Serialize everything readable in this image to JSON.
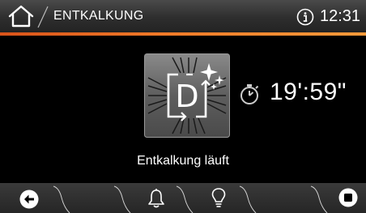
{
  "header": {
    "title": "ENTKALKUNG",
    "time": "12:31",
    "home_icon": "home-icon",
    "info_icon": "info-icon",
    "accent_color": "#f07a28"
  },
  "main": {
    "program_icon": "descaling-icon",
    "program_letter": "D",
    "timer_icon": "stopwatch-icon",
    "remaining_time": "19':59\"",
    "status": "Entkalkung läuft"
  },
  "footer": {
    "buttons": [
      {
        "icon": "back-arrow-icon"
      },
      {
        "icon": "bell-icon"
      },
      {
        "icon": "lightbulb-icon"
      },
      {
        "icon": "stop-icon"
      }
    ]
  }
}
